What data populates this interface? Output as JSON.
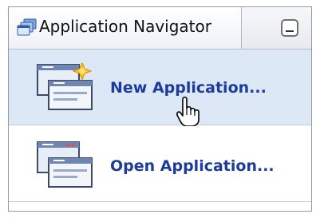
{
  "panel": {
    "title": "Application Navigator",
    "icons": {
      "tab": "application-navigator-icon",
      "minimize": "minimize-icon"
    }
  },
  "actions": [
    {
      "label": "New Application...",
      "icon": "new-application-icon",
      "highlighted": true
    },
    {
      "label": "Open Application...",
      "icon": "open-application-icon",
      "highlighted": false
    }
  ],
  "cursor": {
    "icon": "hand-pointer-icon"
  },
  "colors": {
    "link": "#1c3b9a",
    "hover_bg": "#dde8f6"
  }
}
